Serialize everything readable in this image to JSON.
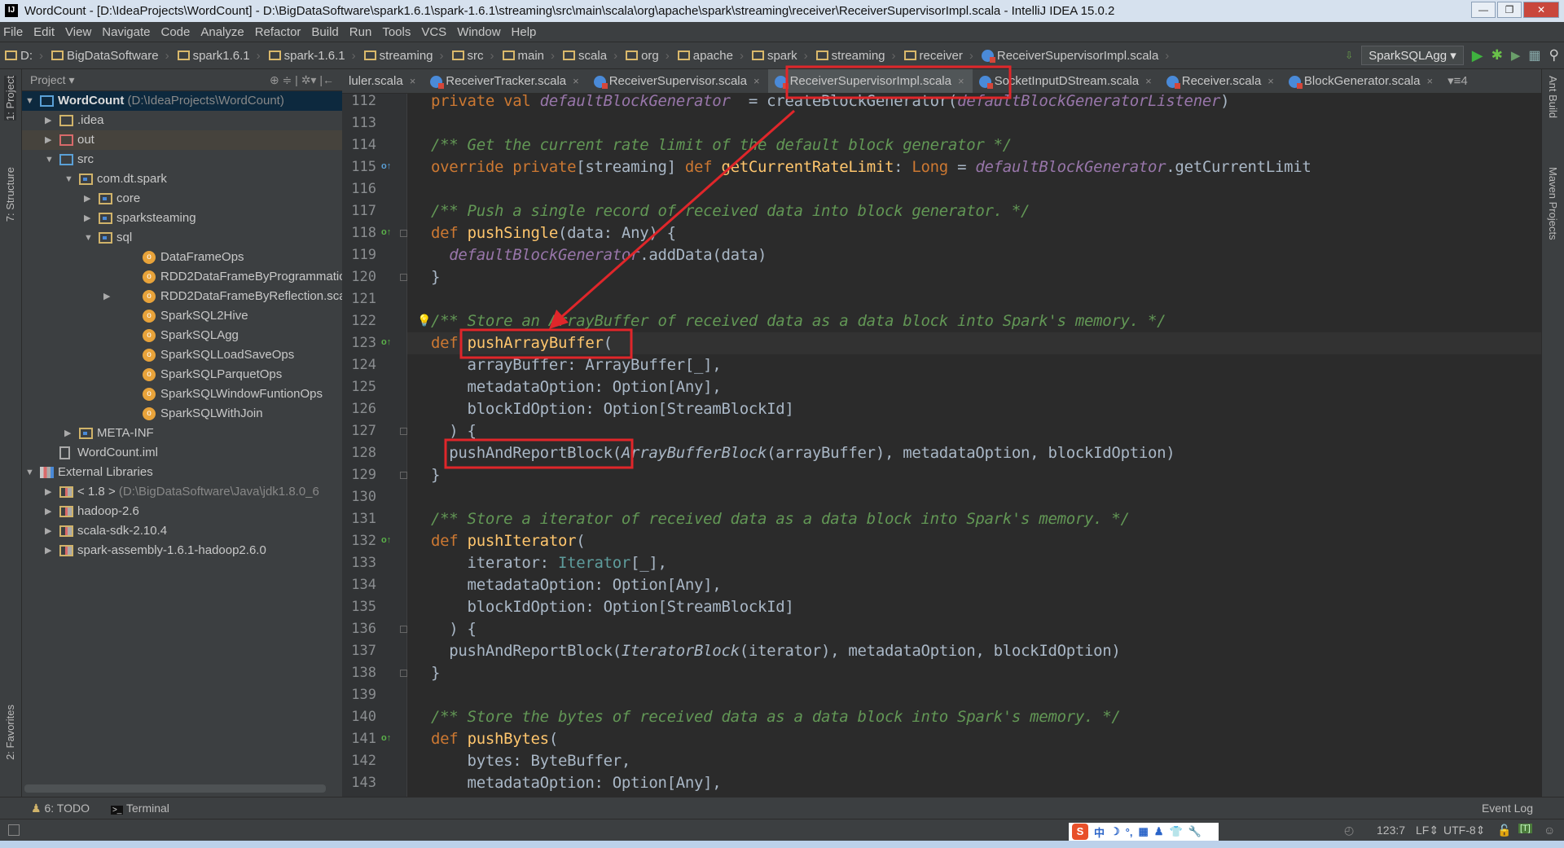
{
  "window": {
    "title": "WordCount - [D:\\IdeaProjects\\WordCount] - D:\\BigDataSoftware\\spark1.6.1\\spark-1.6.1\\streaming\\src\\main\\scala\\org\\apache\\spark\\streaming\\receiver\\ReceiverSupervisorImpl.scala - IntelliJ IDEA 15.0.2",
    "logo": "IJ",
    "minimize": "—",
    "maximize": "❐",
    "close": "✕"
  },
  "menu": [
    "File",
    "Edit",
    "View",
    "Navigate",
    "Code",
    "Analyze",
    "Refactor",
    "Build",
    "Run",
    "Tools",
    "VCS",
    "Window",
    "Help"
  ],
  "breadcrumbs": [
    "D:",
    "BigDataSoftware",
    "spark1.6.1",
    "spark-1.6.1",
    "streaming",
    "src",
    "main",
    "scala",
    "org",
    "apache",
    "spark",
    "streaming",
    "receiver",
    "ReceiverSupervisorImpl.scala"
  ],
  "toolbar": {
    "run_config": "SparkSQLAgg ▾",
    "run_icon": "play-icon",
    "debug_icon": "bug-icon",
    "search_icon": "magnifier-icon"
  },
  "left_strip": {
    "project": "1: Project",
    "structure": "7: Structure",
    "favorites": "2: Favorites"
  },
  "right_strip": {
    "ant": "Ant Build",
    "maven": "Maven Projects"
  },
  "project_panel": {
    "title": "Project ▾",
    "tools": "⊕ ≑ | ✲▾ |←"
  },
  "tree": [
    {
      "level": 0,
      "arrow": "open",
      "icon": "module",
      "label": "WordCount",
      "hint": "(D:\\IdeaProjects\\WordCount)",
      "bold": true,
      "state": "selected"
    },
    {
      "level": 1,
      "arrow": "closed",
      "icon": "folder",
      "label": ".idea"
    },
    {
      "level": 1,
      "arrow": "closed",
      "icon": "folder-red",
      "label": "out",
      "state": "highlight"
    },
    {
      "level": 1,
      "arrow": "open",
      "icon": "folder-blue",
      "label": "src"
    },
    {
      "level": 2,
      "arrow": "open",
      "icon": "package",
      "label": "com.dt.spark"
    },
    {
      "level": 3,
      "arrow": "closed",
      "icon": "package",
      "label": "core"
    },
    {
      "level": 3,
      "arrow": "closed",
      "icon": "package",
      "label": "sparksteaming"
    },
    {
      "level": 3,
      "arrow": "open",
      "icon": "package",
      "label": "sql"
    },
    {
      "level": 4,
      "arrow": "none",
      "icon": "object",
      "label": "DataFrameOps"
    },
    {
      "level": 4,
      "arrow": "none",
      "icon": "object",
      "label": "RDD2DataFrameByProgrammatica"
    },
    {
      "level": 4,
      "arrow": "closed",
      "icon": "object",
      "label": "RDD2DataFrameByReflection.scala"
    },
    {
      "level": 4,
      "arrow": "none",
      "icon": "object",
      "label": "SparkSQL2Hive"
    },
    {
      "level": 4,
      "arrow": "none",
      "icon": "object",
      "label": "SparkSQLAgg"
    },
    {
      "level": 4,
      "arrow": "none",
      "icon": "object",
      "label": "SparkSQLLoadSaveOps"
    },
    {
      "level": 4,
      "arrow": "none",
      "icon": "object",
      "label": "SparkSQLParquetOps"
    },
    {
      "level": 4,
      "arrow": "none",
      "icon": "object",
      "label": "SparkSQLWindowFuntionOps"
    },
    {
      "level": 4,
      "arrow": "none",
      "icon": "object",
      "label": "SparkSQLWithJoin"
    },
    {
      "level": 2,
      "arrow": "closed",
      "icon": "package",
      "label": "META-INF"
    },
    {
      "level": 1,
      "arrow": "none",
      "icon": "file",
      "label": "WordCount.iml"
    },
    {
      "level": 0,
      "arrow": "open",
      "icon": "library",
      "label": "External Libraries"
    },
    {
      "level": 1,
      "arrow": "closed",
      "icon": "library-folder",
      "label": "< 1.8 >",
      "hint": "(D:\\BigDataSoftware\\Java\\jdk1.8.0_6"
    },
    {
      "level": 1,
      "arrow": "closed",
      "icon": "library-folder",
      "label": "hadoop-2.6"
    },
    {
      "level": 1,
      "arrow": "closed",
      "icon": "library-folder",
      "label": "scala-sdk-2.10.4"
    },
    {
      "level": 1,
      "arrow": "closed",
      "icon": "library-folder",
      "label": "spark-assembly-1.6.1-hadoop2.6.0"
    }
  ],
  "tabs": [
    {
      "label": "luler.scala",
      "icon": false
    },
    {
      "label": "ReceiverTracker.scala",
      "icon": true
    },
    {
      "label": "ReceiverSupervisor.scala",
      "icon": true
    },
    {
      "label": "ReceiverSupervisorImpl.scala",
      "icon": true,
      "active": true
    },
    {
      "label": "SocketInputDStream.scala",
      "icon": true
    },
    {
      "label": "Receiver.scala",
      "icon": true
    },
    {
      "label": "BlockGenerator.scala",
      "icon": true
    }
  ],
  "tab_overflow": "▾≡4",
  "editor": {
    "first_line": 112,
    "current_line": 123,
    "lines": [
      [
        [
          "kw",
          "private val "
        ],
        [
          "pf",
          "defaultBlockGenerator"
        ],
        [
          "",
          "  = createBlockGenerator("
        ],
        [
          "pf",
          "defaultBlockGeneratorListener"
        ],
        [
          "",
          ")"
        ]
      ],
      [],
      [
        [
          "cm",
          "/** Get the current rate limit of the default block generator */"
        ]
      ],
      [
        [
          "kw",
          "override private"
        ],
        [
          "",
          "[streaming] "
        ],
        [
          "kw",
          "def "
        ],
        [
          "fn",
          "getCurrentRateLimit"
        ],
        [
          "",
          ": "
        ],
        [
          "kw",
          "Long"
        ],
        [
          "",
          " = "
        ],
        [
          "pf",
          "defaultBlockGenerator"
        ],
        [
          "",
          ".getCurrentLimit"
        ]
      ],
      [],
      [
        [
          "cm",
          "/** Push a single record of received data into block generator. */"
        ]
      ],
      [
        [
          "kw",
          "def "
        ],
        [
          "fn",
          "pushSingle"
        ],
        [
          "",
          "(data: Any) {"
        ]
      ],
      [
        [
          "",
          "  "
        ],
        [
          "pf",
          "defaultBlockGenerator"
        ],
        [
          "",
          ".addData(data)"
        ]
      ],
      [
        [
          "",
          "}"
        ]
      ],
      [],
      [
        [
          "cm",
          "/** Store an ArrayBuffer of received data as a data block into Spark's memory. */"
        ]
      ],
      [
        [
          "kw",
          "def "
        ],
        [
          "fn",
          "pushArrayBuffer"
        ],
        [
          "",
          "("
        ]
      ],
      [
        [
          "",
          "    arrayBuffer: ArrayBuffer[_],"
        ]
      ],
      [
        [
          "",
          "    metadataOption: Option[Any],"
        ]
      ],
      [
        [
          "",
          "    blockIdOption: Option[StreamBlockId]"
        ]
      ],
      [
        [
          "",
          "  ) {"
        ]
      ],
      [
        [
          "",
          "  pushAndReportBlock("
        ],
        [
          "it",
          "ArrayBufferBlock"
        ],
        [
          "",
          "(arrayBuffer), metadataOption, blockIdOption)"
        ]
      ],
      [
        [
          "",
          "}"
        ]
      ],
      [],
      [
        [
          "cm",
          "/** Store a iterator of received data as a data block into Spark's memory. */"
        ]
      ],
      [
        [
          "kw",
          "def "
        ],
        [
          "fn",
          "pushIterator"
        ],
        [
          "",
          "("
        ]
      ],
      [
        [
          "",
          "    iterator: "
        ],
        [
          "tp",
          "Iterator"
        ],
        [
          "",
          "[_],"
        ]
      ],
      [
        [
          "",
          "    metadataOption: Option[Any],"
        ]
      ],
      [
        [
          "",
          "    blockIdOption: Option[StreamBlockId]"
        ]
      ],
      [
        [
          "",
          "  ) {"
        ]
      ],
      [
        [
          "",
          "  pushAndReportBlock("
        ],
        [
          "it",
          "IteratorBlock"
        ],
        [
          "",
          "(iterator), metadataOption, blockIdOption)"
        ]
      ],
      [
        [
          "",
          "}"
        ]
      ],
      [],
      [
        [
          "cm",
          "/** Store the bytes of received data as a data block into Spark's memory. */"
        ]
      ],
      [
        [
          "kw",
          "def "
        ],
        [
          "fn",
          "pushBytes"
        ],
        [
          "",
          "("
        ]
      ],
      [
        [
          "",
          "    bytes: ByteBuffer,"
        ]
      ],
      [
        [
          "",
          "    metadataOption: Option[Any],"
        ]
      ]
    ],
    "override_markers": [
      115,
      118,
      123,
      132,
      141
    ],
    "fold_markers": [
      118,
      120,
      127,
      129,
      136,
      138
    ],
    "bulb_line": 122
  },
  "bottom_tools": {
    "todo": "6: TODO",
    "terminal": "Terminal",
    "event_log": "Event Log"
  },
  "status": {
    "position": "123:7",
    "line_sep": "LF⇕",
    "encoding": "UTF-8⇕",
    "ime": [
      "S",
      "中",
      "☽",
      "°,",
      "▦",
      "♟",
      "👕",
      "🔧"
    ]
  },
  "annotation_color": "#e0262a"
}
